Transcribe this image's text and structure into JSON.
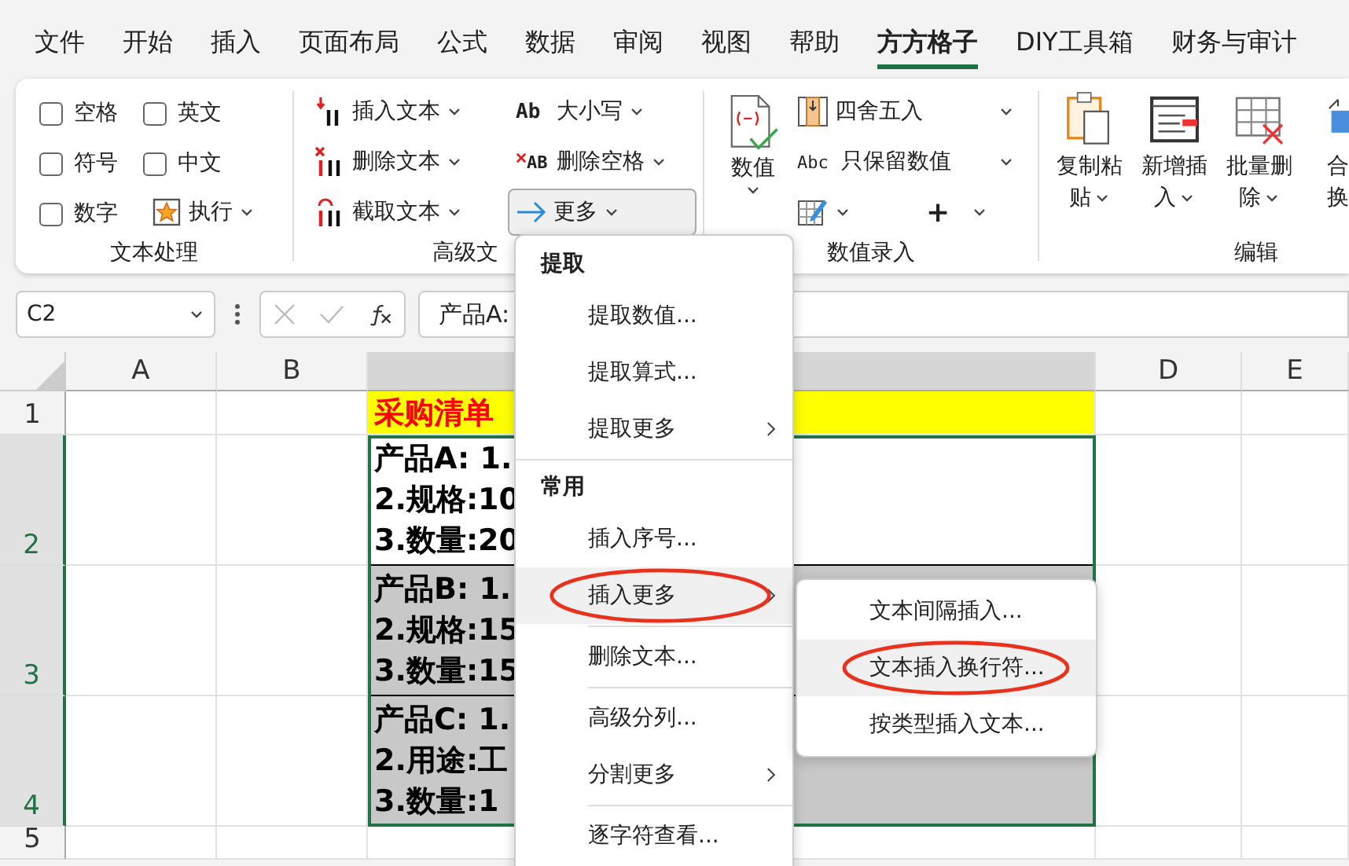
{
  "menu_tabs": [
    {
      "label": "文件",
      "selected": false
    },
    {
      "label": "开始",
      "selected": false
    },
    {
      "label": "插入",
      "selected": false
    },
    {
      "label": "页面布局",
      "selected": false
    },
    {
      "label": "公式",
      "selected": false
    },
    {
      "label": "数据",
      "selected": false
    },
    {
      "label": "审阅",
      "selected": false
    },
    {
      "label": "视图",
      "selected": false
    },
    {
      "label": "帮助",
      "selected": false
    },
    {
      "label": "方方格子",
      "selected": true
    },
    {
      "label": "DIY工具箱",
      "selected": false
    },
    {
      "label": "财务与审计",
      "selected": false
    }
  ],
  "ribbon": {
    "groups": [
      {
        "kind": "checks",
        "label": "文本处理",
        "items": [
          {
            "kind": "checkbox",
            "label": "空格",
            "checked": false
          },
          {
            "kind": "checkbox",
            "label": "英文",
            "checked": false
          },
          {
            "kind": "checkbox",
            "label": "符号",
            "checked": false
          },
          {
            "kind": "checkbox",
            "label": "中文",
            "checked": false
          },
          {
            "kind": "checkbox",
            "label": "数字",
            "checked": false
          },
          {
            "kind": "run",
            "label": "执行"
          }
        ]
      },
      {
        "kind": "text-tools",
        "label": "高级文",
        "items": [
          {
            "label": "插入文本",
            "pressed": false
          },
          {
            "label": "删除文本",
            "pressed": false
          },
          {
            "label": "截取文本",
            "pressed": false
          },
          {
            "label": "大小写",
            "glyph": "Ab",
            "pressed": false
          },
          {
            "label": "删除空格",
            "glyph": "AB",
            "pressed": false
          },
          {
            "label": "更多",
            "pressed": true
          }
        ]
      },
      {
        "kind": "numbers",
        "label": "数值录入",
        "big": {
          "label": "数值"
        },
        "items": [
          {
            "kind": "wide",
            "label": "四舍五入"
          },
          {
            "kind": "wide",
            "label": "只保留数值",
            "glyph": "Abc"
          },
          {
            "kind": "icon-menu"
          },
          {
            "kind": "glyph-menu",
            "glyph": "+"
          }
        ]
      },
      {
        "kind": "edit",
        "label": "编辑",
        "items": [
          {
            "lines": [
              "复制粘",
              "贴"
            ],
            "menu": true
          },
          {
            "lines": [
              "新增插",
              "入"
            ],
            "menu": true
          },
          {
            "lines": [
              "批量删",
              "除"
            ],
            "menu": true
          },
          {
            "lines": [
              "合",
              "换"
            ]
          }
        ]
      }
    ]
  },
  "formula_bar": {
    "name_box": "C2",
    "formula": "产品A:"
  },
  "sheet": {
    "columns": [
      {
        "label": "A",
        "selected": false
      },
      {
        "label": "B",
        "selected": false
      },
      {
        "selected": true
      },
      {
        "label": "D",
        "selected": false
      },
      {
        "label": "E",
        "selected": false
      }
    ],
    "rows": [
      {
        "header": "1",
        "selected": false,
        "cell": {
          "kind": "title",
          "lines": [
            "采购清单"
          ]
        }
      },
      {
        "header": "2",
        "selected": true,
        "cell": {
          "kind": "body",
          "shaded": false,
          "lines": [
            "产品A: 1.",
            "2.规格:10",
            "3.数量:20"
          ]
        }
      },
      {
        "header": "3",
        "selected": true,
        "cell": {
          "kind": "body",
          "shaded": true,
          "lines": [
            "产品B: 1.",
            "2.规格:15",
            "3.数量:15"
          ]
        }
      },
      {
        "header": "4",
        "selected": true,
        "cell": {
          "kind": "body",
          "shaded": true,
          "lines": [
            "产品C: 1.",
            "2.用途:工",
            "3.数量:1"
          ]
        }
      },
      {
        "header": "5",
        "selected": false
      }
    ]
  },
  "dropdown_menu": {
    "items": [
      {
        "kind": "header",
        "label": "提取"
      },
      {
        "kind": "item",
        "label": "提取数值...",
        "submenu": false,
        "highlighted": false,
        "circled": false
      },
      {
        "kind": "item",
        "label": "提取算式...",
        "submenu": false,
        "highlighted": false,
        "circled": false
      },
      {
        "kind": "item",
        "label": "提取更多",
        "submenu": true,
        "highlighted": false,
        "circled": false
      },
      {
        "kind": "separator",
        "indent": false
      },
      {
        "kind": "header",
        "label": "常用"
      },
      {
        "kind": "item",
        "label": "插入序号...",
        "submenu": false,
        "highlighted": false,
        "circled": false
      },
      {
        "kind": "item",
        "label": "插入更多",
        "submenu": true,
        "highlighted": true,
        "circled": true
      },
      {
        "kind": "separator",
        "indent": true
      },
      {
        "kind": "item",
        "label": "删除文本...",
        "submenu": false,
        "highlighted": false,
        "circled": false
      },
      {
        "kind": "separator",
        "indent": true
      },
      {
        "kind": "item",
        "label": "高级分列...",
        "submenu": false,
        "highlighted": false,
        "circled": false
      },
      {
        "kind": "item",
        "label": "分割更多",
        "submenu": true,
        "highlighted": false,
        "circled": false
      },
      {
        "kind": "separator",
        "indent": true
      },
      {
        "kind": "item",
        "label": "逐字符查看...",
        "submenu": false,
        "highlighted": false,
        "circled": false
      }
    ]
  },
  "submenu": {
    "items": [
      {
        "label": "文本间隔插入...",
        "highlighted": false,
        "circled": false
      },
      {
        "label": "文本插入换行符...",
        "highlighted": true,
        "circled": true
      },
      {
        "label": "按类型插入文本...",
        "highlighted": false,
        "circled": false
      }
    ]
  }
}
